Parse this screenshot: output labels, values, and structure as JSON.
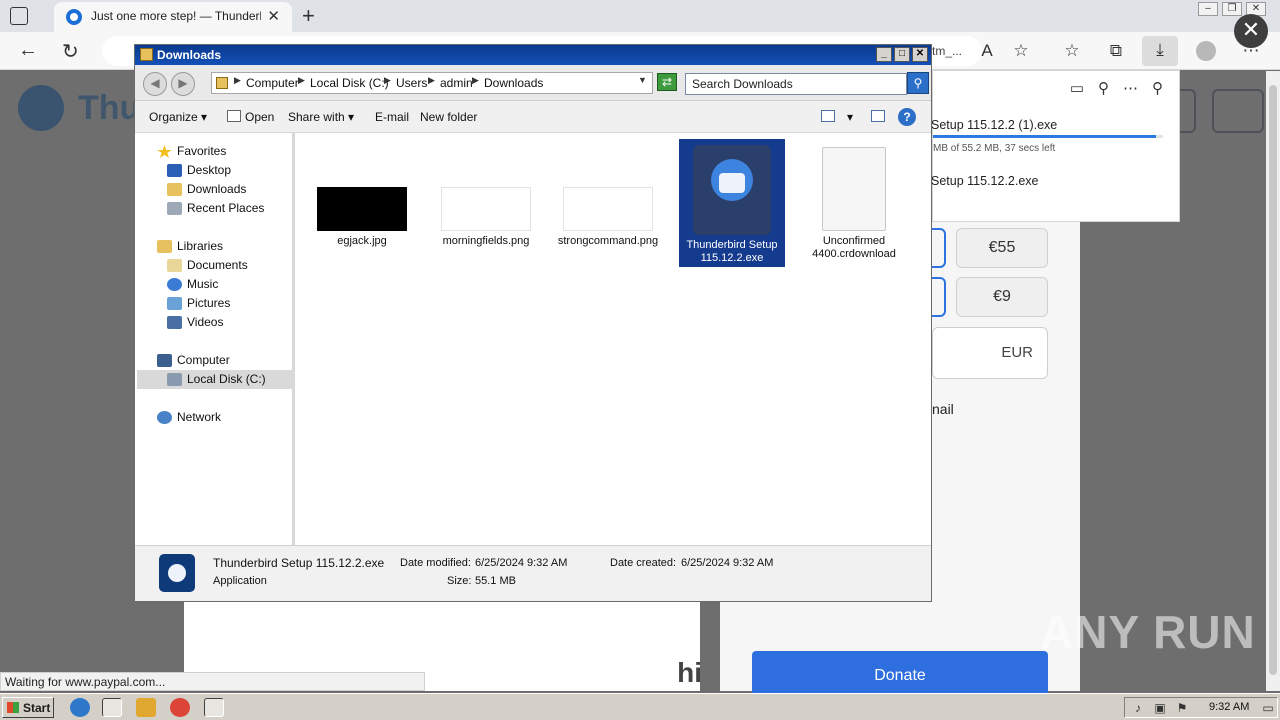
{
  "browser": {
    "tab_title": "Just one more step! — Thunderbird",
    "tab_close": "✕",
    "new_tab": "+",
    "url_fragment": "tm_...",
    "status_text": "Waiting for www.paypal.com...",
    "icons": [
      "back-icon",
      "refresh-icon",
      "read-aloud-icon",
      "add-favorite-icon",
      "favorites-icon",
      "collections-icon",
      "downloads-icon",
      "profile-icon",
      "more-icon"
    ]
  },
  "page": {
    "logo_fragment": "Thu",
    "amounts": [
      "€55",
      "€9"
    ],
    "currency": "EUR",
    "email_fragment": "nail",
    "donate_label": "Donate",
    "left_fragment": "hi",
    "close_symbol": "✕"
  },
  "downloads_flyout": {
    "item1_name": "Setup 115.12.2 (1).exe",
    "item1_status": "MB of 55.2 MB, 37 secs left",
    "item1_progress": 0.97,
    "item2_name": "Setup 115.12.2.exe"
  },
  "explorer": {
    "title": "Downloads",
    "breadcrumbs": [
      "Computer",
      "Local Disk (C:)",
      "Users",
      "admin",
      "Downloads"
    ],
    "search_placeholder": "Search Downloads",
    "commands": {
      "organize": "Organize",
      "open": "Open",
      "share_with": "Share with",
      "email": "E-mail",
      "new_folder": "New folder"
    },
    "nav": {
      "favorites": "Favorites",
      "desktop": "Desktop",
      "downloads": "Downloads",
      "recent_places": "Recent Places",
      "libraries": "Libraries",
      "documents": "Documents",
      "music": "Music",
      "pictures": "Pictures",
      "videos": "Videos",
      "computer": "Computer",
      "local_disk": "Local Disk (C:)",
      "network": "Network"
    },
    "files": [
      {
        "name": "egjack.jpg",
        "selected": false
      },
      {
        "name": "morningfields.png",
        "selected": false
      },
      {
        "name": "strongcommand.png",
        "selected": false
      },
      {
        "name": "Thunderbird Setup 115.12.2.exe",
        "selected": true
      },
      {
        "name": "Unconfirmed 4400.crdownload",
        "selected": false
      }
    ],
    "details": {
      "name": "Thunderbird Setup 115.12.2.exe",
      "type": "Application",
      "date_modified_label": "Date modified:",
      "date_modified": "6/25/2024 9:32 AM",
      "date_created_label": "Date created:",
      "date_created": "6/25/2024 9:32 AM",
      "size_label": "Size:",
      "size": "55.1 MB"
    }
  },
  "taskbar": {
    "start_label": "Start",
    "clock": "9:32 AM"
  },
  "watermark": "ANY RUN"
}
